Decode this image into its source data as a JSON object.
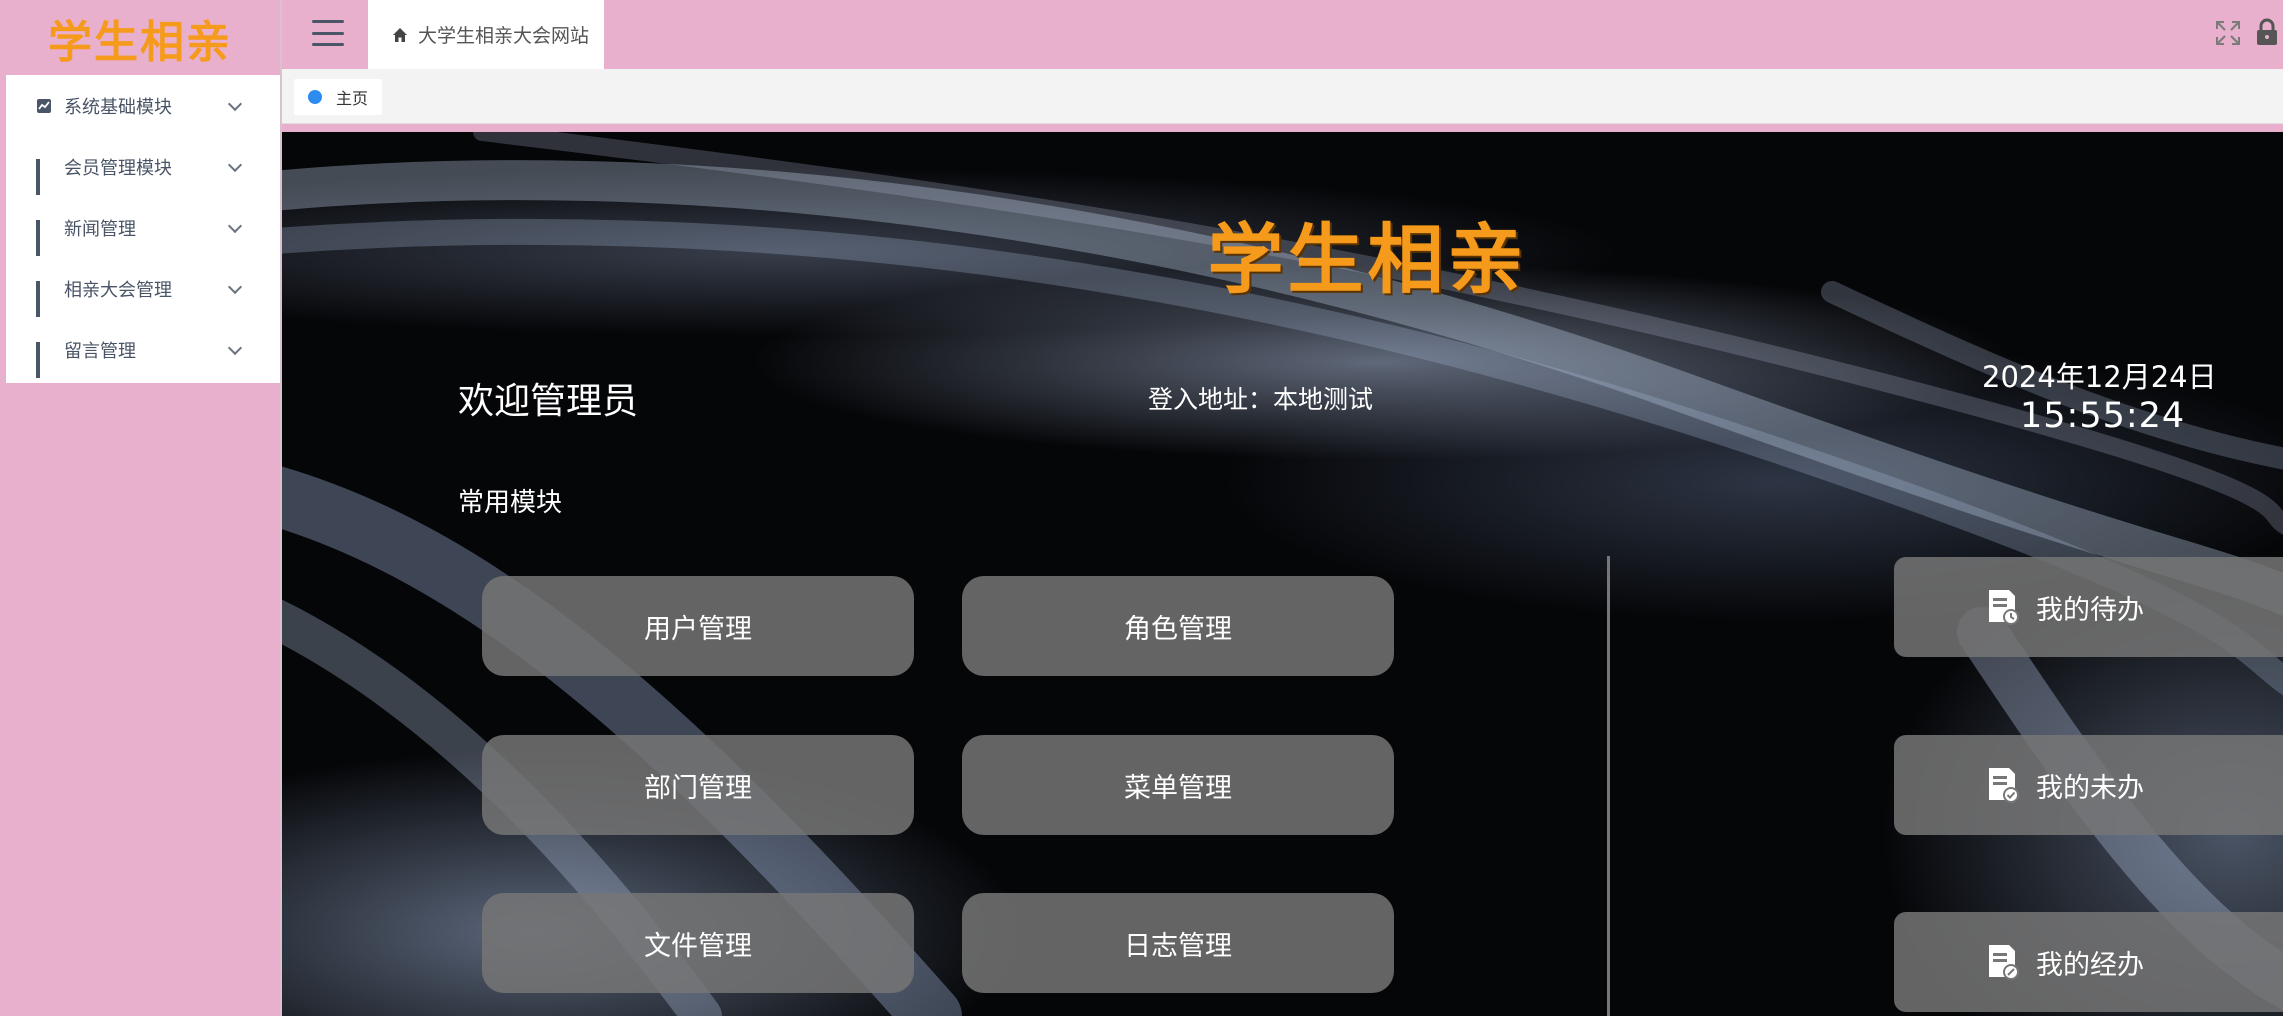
{
  "app": {
    "logo_text": "学生相亲",
    "brand_color": "#f59a1b",
    "sidebar_bg": "#e8b0cc"
  },
  "sidebar": {
    "items": [
      {
        "label": "系统基础模块",
        "icon": "chart-check-icon"
      },
      {
        "label": "会员管理模块",
        "icon": "grid-icon"
      },
      {
        "label": "新闻管理",
        "icon": "grid-icon"
      },
      {
        "label": "相亲大会管理",
        "icon": "grid-icon"
      },
      {
        "label": "留言管理",
        "icon": "grid-icon"
      }
    ]
  },
  "header": {
    "tab_label": "大学生相亲大会网站",
    "tab_icon": "home-icon"
  },
  "tags": {
    "items": [
      {
        "label": "主页",
        "dot_color": "#2d8cf0"
      }
    ]
  },
  "main": {
    "title": "学生相亲",
    "welcome": "欢迎管理员",
    "login_address": "登入地址：本地测试",
    "date": "2024年12月24日",
    "time": "15:55:24",
    "section_title": "常用模块",
    "modules": [
      "用户管理",
      "角色管理",
      "部门管理",
      "菜单管理",
      "文件管理",
      "日志管理"
    ],
    "tasks": [
      "我的待办",
      "我的未办",
      "我的经办"
    ]
  }
}
